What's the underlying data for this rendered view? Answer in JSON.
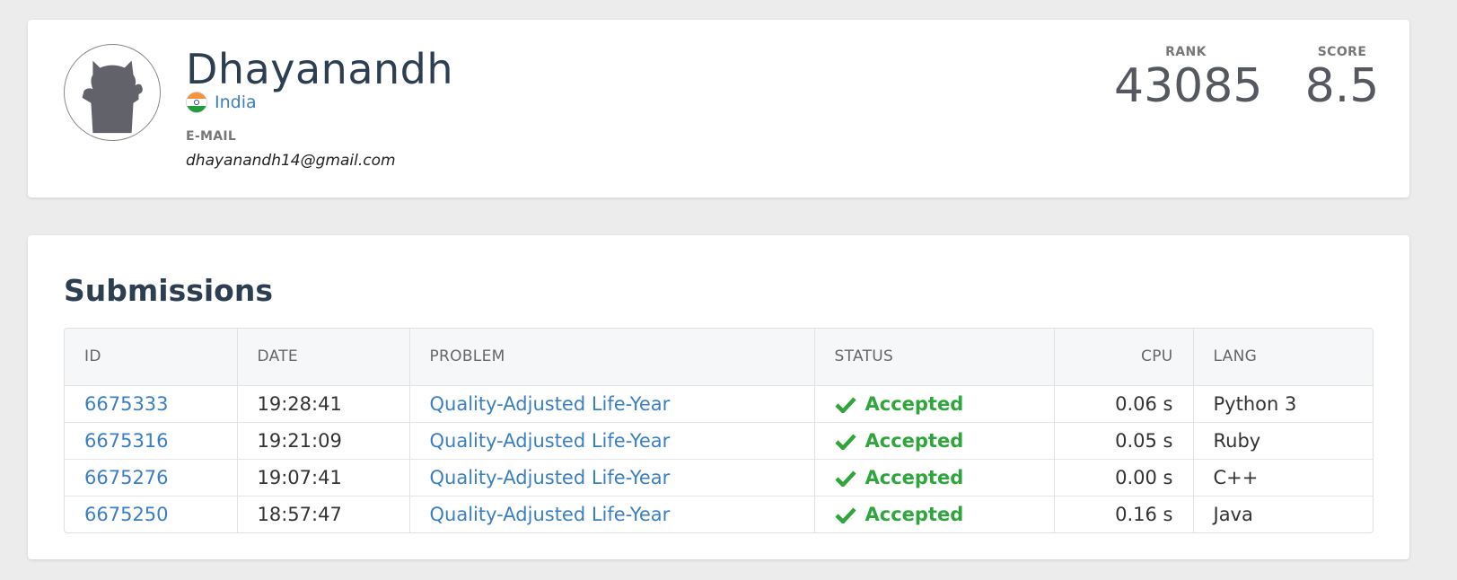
{
  "profile": {
    "username": "Dhayanandh",
    "country": "India",
    "email_label": "E-MAIL",
    "email": "dhayanandh14@gmail.com",
    "rank_label": "RANK",
    "rank": "43085",
    "score_label": "SCORE",
    "score": "8.5"
  },
  "submissions": {
    "title": "Submissions",
    "columns": {
      "id": "ID",
      "date": "DATE",
      "problem": "PROBLEM",
      "status": "STATUS",
      "cpu": "CPU",
      "lang": "LANG"
    },
    "rows": [
      {
        "id": "6675333",
        "date": "19:28:41",
        "problem": "Quality-Adjusted Life-Year",
        "status": "Accepted",
        "cpu": "0.06 s",
        "lang": "Python 3"
      },
      {
        "id": "6675316",
        "date": "19:21:09",
        "problem": "Quality-Adjusted Life-Year",
        "status": "Accepted",
        "cpu": "0.05 s",
        "lang": "Ruby"
      },
      {
        "id": "6675276",
        "date": "19:07:41",
        "problem": "Quality-Adjusted Life-Year",
        "status": "Accepted",
        "cpu": "0.00 s",
        "lang": "C++"
      },
      {
        "id": "6675250",
        "date": "18:57:47",
        "problem": "Quality-Adjusted Life-Year",
        "status": "Accepted",
        "cpu": "0.16 s",
        "lang": "Java"
      }
    ]
  },
  "icons": {
    "avatar": "default-avatar-icon",
    "flag": "india-flag-icon",
    "status": "checkmark-icon"
  },
  "colors": {
    "link": "#3a7fc4",
    "accepted": "#2ea63c",
    "title": "#2c3e50"
  }
}
